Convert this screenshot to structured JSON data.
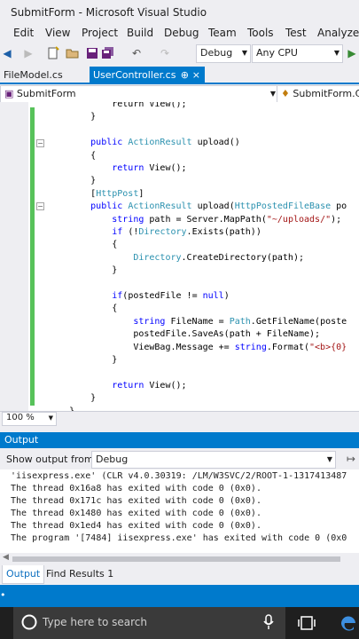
{
  "window": {
    "title": "SubmitForm - Microsoft Visual Studio"
  },
  "menu": [
    "Edit",
    "View",
    "Project",
    "Build",
    "Debug",
    "Team",
    "Tools",
    "Test",
    "Analyze"
  ],
  "toolbar": {
    "config": "Debug",
    "platform": "Any CPU"
  },
  "doc_tabs": [
    {
      "label": "FileModel.cs"
    },
    {
      "label": "UserController.cs",
      "pin": "⊕",
      "close": "×"
    }
  ],
  "navbar": {
    "project": "SubmitForm",
    "class": "SubmitForm.Co"
  },
  "editor": {
    "zoom": "100 %",
    "lines": [
      [
        [
          "",
          "            return View();"
        ]
      ],
      [
        [
          "",
          "        }"
        ]
      ],
      [
        [
          "",
          ""
        ]
      ],
      [
        [
          "kw",
          "        public "
        ],
        [
          "ty",
          "ActionResult"
        ],
        [
          "",
          " upload()"
        ]
      ],
      [
        [
          "",
          "        {"
        ]
      ],
      [
        [
          "",
          "            "
        ],
        [
          "kw",
          "return"
        ],
        [
          "",
          " View();"
        ]
      ],
      [
        [
          "",
          "        }"
        ]
      ],
      [
        [
          "",
          "        ["
        ],
        [
          "ty",
          "HttpPost"
        ],
        [
          "",
          "]"
        ]
      ],
      [
        [
          "kw",
          "        public "
        ],
        [
          "ty",
          "ActionResult"
        ],
        [
          "",
          " upload("
        ],
        [
          "ty",
          "HttpPostedFileBase"
        ],
        [
          "",
          " po"
        ]
      ],
      [
        [
          "",
          "            "
        ],
        [
          "kw",
          "string"
        ],
        [
          "",
          " path = Server.MapPath("
        ],
        [
          "st",
          "\"~/uploads/\""
        ],
        [
          "",
          ");"
        ]
      ],
      [
        [
          "",
          "            "
        ],
        [
          "kw",
          "if"
        ],
        [
          "",
          " (!"
        ],
        [
          "ty",
          "Directory"
        ],
        [
          "",
          ".Exists(path))"
        ]
      ],
      [
        [
          "",
          "            {"
        ]
      ],
      [
        [
          "",
          "                "
        ],
        [
          "ty",
          "Directory"
        ],
        [
          "",
          ".CreateDirectory(path);"
        ]
      ],
      [
        [
          "",
          "            }"
        ]
      ],
      [
        [
          "",
          ""
        ]
      ],
      [
        [
          "",
          "            "
        ],
        [
          "kw",
          "if"
        ],
        [
          "",
          "(postedFile != "
        ],
        [
          "kw",
          "null"
        ],
        [
          "",
          ")"
        ]
      ],
      [
        [
          "",
          "            {"
        ]
      ],
      [
        [
          "",
          "                "
        ],
        [
          "kw",
          "string"
        ],
        [
          "",
          " FileName = "
        ],
        [
          "ty",
          "Path"
        ],
        [
          "",
          ".GetFileName(poste"
        ]
      ],
      [
        [
          "",
          "                postedFile.SaveAs(path + FileName);"
        ]
      ],
      [
        [
          "",
          "                ViewBag.Message += "
        ],
        [
          "kw",
          "string"
        ],
        [
          "",
          ".Format("
        ],
        [
          "st",
          "\"<b>{0}"
        ]
      ],
      [
        [
          "",
          "            }"
        ]
      ],
      [
        [
          "",
          ""
        ]
      ],
      [
        [
          "",
          "            "
        ],
        [
          "kw",
          "return"
        ],
        [
          "",
          " View();"
        ]
      ],
      [
        [
          "",
          "        }"
        ]
      ],
      [
        [
          "",
          "    }"
        ]
      ]
    ]
  },
  "output": {
    "title": "Output",
    "show_from_label": "Show output from:",
    "source": "Debug",
    "lines": [
      "'iisexpress.exe' (CLR v4.0.30319: /LM/W3SVC/2/ROOT-1-1317413487",
      "The thread 0x16a8 has exited with code 0 (0x0).",
      "The thread 0x171c has exited with code 0 (0x0).",
      "The thread 0x1480 has exited with code 0 (0x0).",
      "The thread 0x1ed4 has exited with code 0 (0x0).",
      "The program '[7484] iisexpress.exe' has exited with code 0 (0x0"
    ]
  },
  "bottom_tabs": [
    "Output",
    "Find Results 1"
  ],
  "taskbar": {
    "search_placeholder": "Type here to search"
  },
  "colors": {
    "accent": "#007acc",
    "change_bar": "#57c25a",
    "keyword": "#0000ff",
    "type": "#2b91af",
    "string": "#a31515"
  },
  "icons": [
    "back-icon",
    "forward-icon",
    "new-project-icon",
    "open-icon",
    "save-icon",
    "save-all-icon",
    "undo-icon",
    "redo-icon",
    "start-icon",
    "search-icon",
    "microphone-icon",
    "task-view-icon",
    "edge-icon"
  ]
}
